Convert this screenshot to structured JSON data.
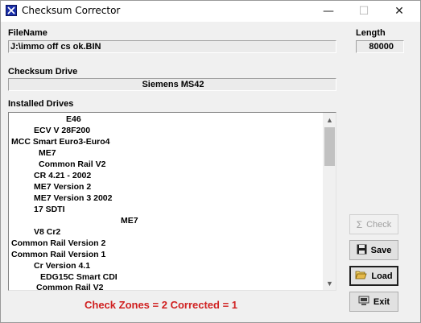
{
  "window": {
    "title": "Checksum Corrector",
    "controls": {
      "minimize": "—",
      "maximize": "☐",
      "close": "✕"
    }
  },
  "filename": {
    "label": "FileName",
    "value": "J:\\immo off cs ok.BIN"
  },
  "length": {
    "label": "Length",
    "value": "80000"
  },
  "checksum_drive": {
    "label": "Checksum Drive",
    "value": "Siemens MS42"
  },
  "installed_drives": {
    "label": "Installed Drives",
    "items": [
      "E46",
      "ECV V 28F200",
      "MCC Smart Euro3-Euro4",
      "ME7",
      "Common Rail V2",
      "CR 4.21 - 2002",
      "ME7 Version 2",
      "ME7 Version 3 2002",
      "17 SDTI",
      "ME7",
      "V8 Cr2",
      "Common Rail Version 2",
      "Common Rail Version 1",
      "Cr Version 4.1",
      "EDG15C Smart CDI",
      "Common Rail V2"
    ]
  },
  "buttons": {
    "check": {
      "label": "Check",
      "icon": "sigma-icon",
      "enabled": false
    },
    "save": {
      "label": "Save",
      "icon": "floppy-disk-icon"
    },
    "load": {
      "label": "Load",
      "icon": "open-folder-icon"
    },
    "exit": {
      "label": "Exit",
      "icon": "computer-icon"
    }
  },
  "status": {
    "text": "Check Zones = 2 Corrected = 1",
    "color": "#d02020"
  }
}
